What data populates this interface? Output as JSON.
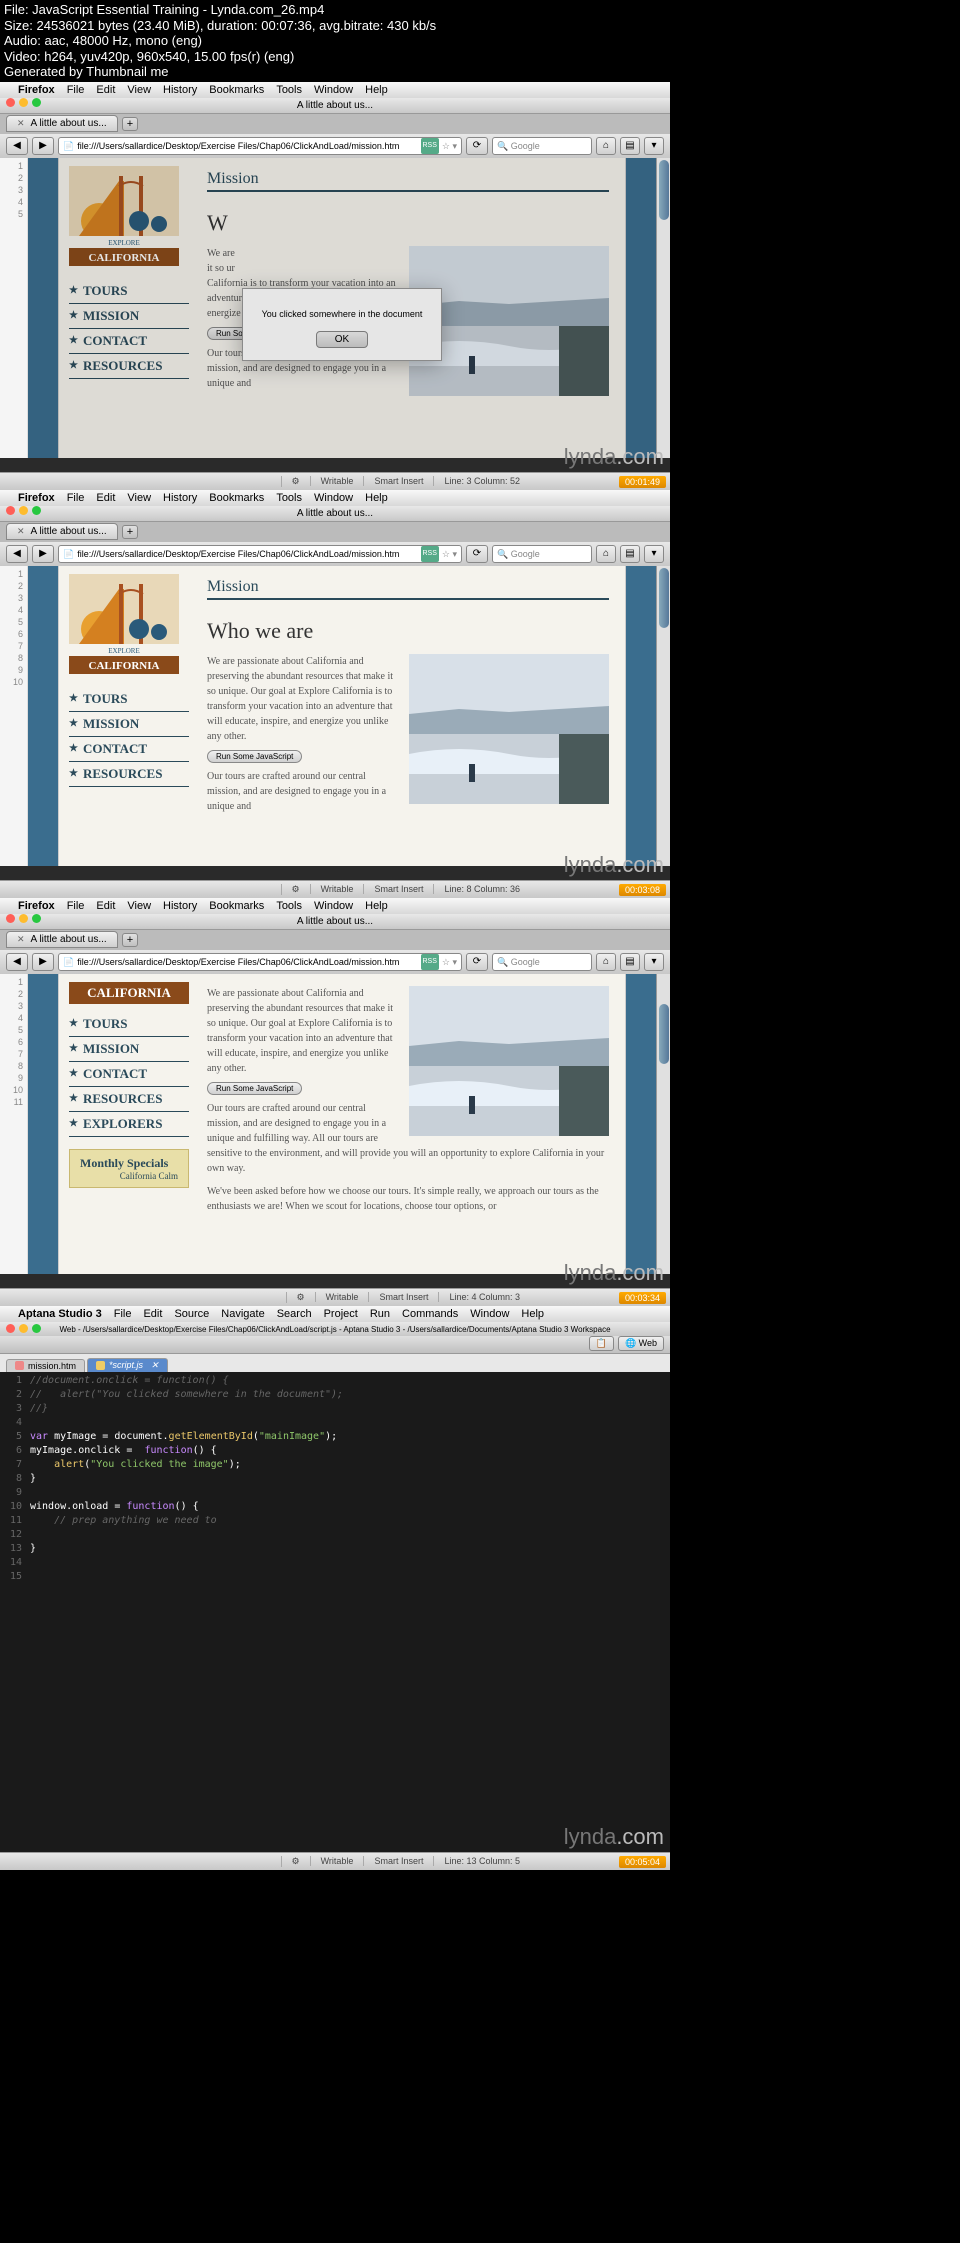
{
  "header": {
    "file": "File: JavaScript Essential Training - Lynda.com_26.mp4",
    "size": "Size: 24536021 bytes (23.40 MiB), duration: 00:07:36, avg.bitrate: 430 kb/s",
    "audio": "Audio: aac, 48000 Hz, mono (eng)",
    "video": "Video: h264, yuv420p, 960x540, 15.00 fps(r) (eng)",
    "gen": "Generated by Thumbnail me"
  },
  "menu": {
    "apple": "",
    "app": "Firefox",
    "items": [
      "File",
      "Edit",
      "View",
      "History",
      "Bookmarks",
      "Tools",
      "Window",
      "Help"
    ]
  },
  "aptana_menu": {
    "apple": "",
    "app": "Aptana Studio 3",
    "items": [
      "File",
      "Edit",
      "Source",
      "Navigate",
      "Search",
      "Project",
      "Run",
      "Commands",
      "Window",
      "Help"
    ]
  },
  "window_title": "A little about us...",
  "tab_title": "A little about us...",
  "url": "file:///Users/sallardice/Desktop/Exercise Files/Chap06/ClickAndLoad/mission.htm",
  "rss": "RSS",
  "search_placeholder": "Google",
  "lines1": [
    "1",
    "2",
    "3",
    "4",
    "5"
  ],
  "lines2": [
    "1",
    "2",
    "3",
    "4",
    "5",
    "6",
    "7",
    "8",
    "9",
    "10"
  ],
  "lines3": [
    "1",
    "2",
    "3",
    "4",
    "5",
    "6",
    "7",
    "8",
    "9",
    "10",
    "11"
  ],
  "page_nav": [
    "TOURS",
    "MISSION",
    "CONTACT",
    "RESOURCES",
    "EXPLORERS"
  ],
  "logo_top": "EXPLORE",
  "logo_bottom": "CALIFORNIA",
  "content": {
    "h1": "Mission",
    "h2": "Who we are",
    "p1_full": "We are passionate about California and preserving the abundant resources that make it so unique. Our goal at Explore California is to transform your vacation into an adventure that will educate, inspire, and energize you unlike any other.",
    "p1_short": "We are passionate about California and preserving the abundant resources that make it so unique. Our goal at Explore California is to transform your vacation into an adventure that will educate, inspire, and energize you unlike any other.",
    "run_btn": "Run Some JavaScript",
    "p2": "Our tours are crafted around our central mission, and are designed to engage you in a unique and fulfilling way. All our tours are sensitive to the environment, and will provide you will an opportunity to explore California in your own way.",
    "p3": "We've been asked before how we choose our tours. It's simple really, we approach our tours as the enthusiasts we are! When we scout for locations, choose tour options, or"
  },
  "dialog": {
    "text": "You clicked somewhere in the document",
    "ok": "OK"
  },
  "monthly": {
    "title": "Monthly Specials",
    "sub": "California Calm"
  },
  "status1": {
    "writable": "Writable",
    "insert": "Smart Insert",
    "pos": "Line: 3 Column: 52"
  },
  "status2": {
    "writable": "Writable",
    "insert": "Smart Insert",
    "pos": "Line: 8 Column: 36"
  },
  "status3": {
    "writable": "Writable",
    "insert": "Smart Insert",
    "pos": "Line: 4 Column: 3"
  },
  "status4": {
    "writable": "Writable",
    "insert": "Smart Insert",
    "pos": "Line: 13 Column: 5"
  },
  "timecodes": [
    "00:01:49",
    "00:03:08",
    "00:03:34",
    "00:05:04"
  ],
  "watermark": {
    "lynda": "lynda",
    "com": ".com"
  },
  "aptana": {
    "title": "Web - /Users/sallardice/Desktop/Exercise Files/Chap06/ClickAndLoad/script.js - Aptana Studio 3 - /Users/sallardice/Documents/Aptana Studio 3 Workspace",
    "tabs": [
      {
        "label": "mission.htm",
        "active": false
      },
      {
        "label": "*script.js",
        "active": true
      }
    ],
    "persp": "Web",
    "code_lines": [
      "1",
      "2",
      "3",
      "4",
      "5",
      "6",
      "7",
      "8",
      "9",
      "10",
      "11",
      "12",
      "13",
      "14",
      "15"
    ]
  }
}
